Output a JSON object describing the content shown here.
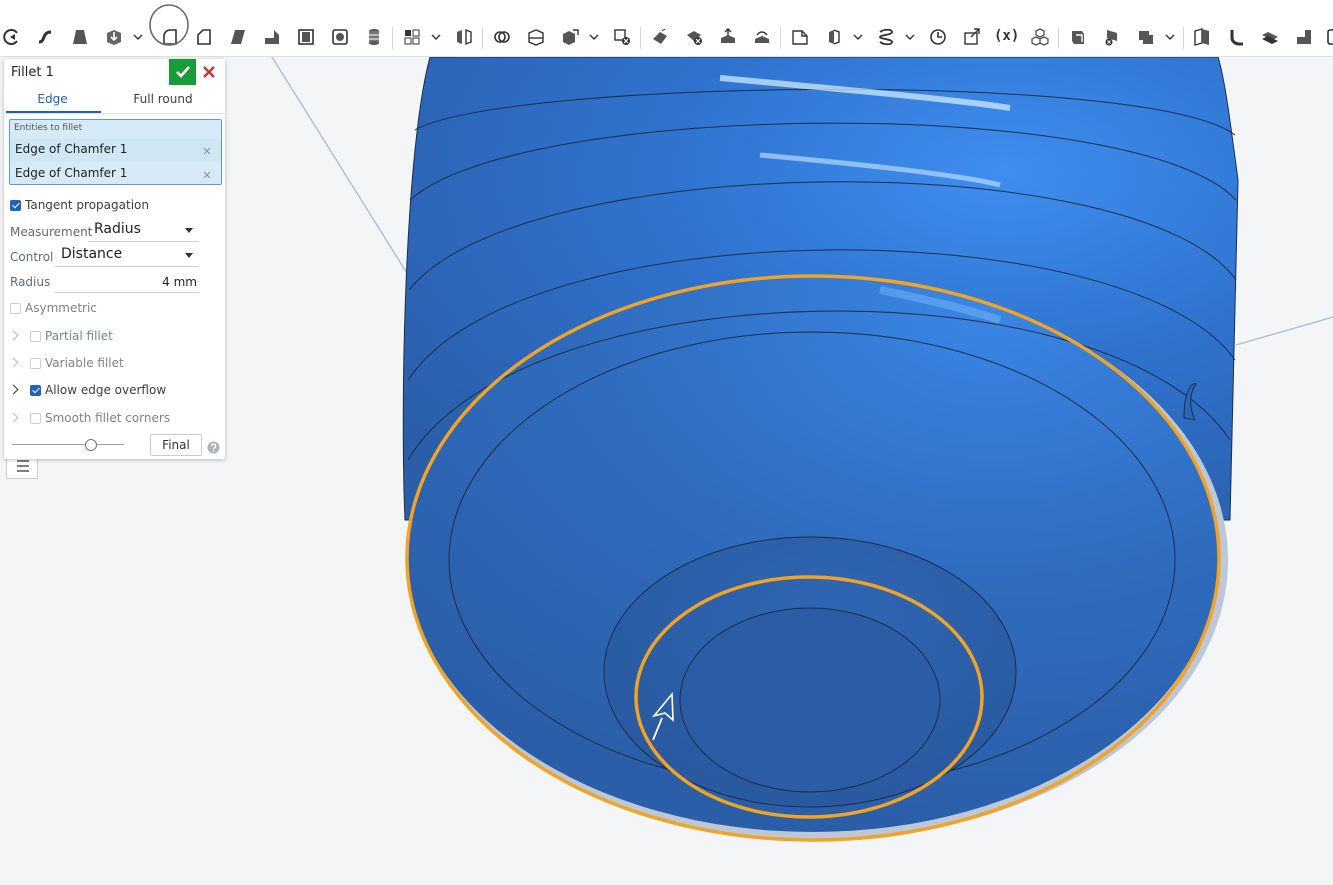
{
  "toolbar": {
    "icons": [
      "sketch-icon",
      "sweep-icon",
      "loft-icon",
      "extrude-icon",
      "fillet-icon",
      "chamfer-icon",
      "draft-icon",
      "rib-icon",
      "shell-icon",
      "hole-icon",
      "thread-icon",
      "pattern-icon",
      "mirror-icon",
      "boolean-icon",
      "split-icon",
      "transform-icon",
      "delete-part-icon",
      "modify-fillet-icon",
      "delete-face-icon",
      "move-face-icon",
      "replace-face-icon",
      "plane-icon",
      "wrap-icon",
      "helix-icon",
      "clock-icon",
      "import-icon",
      "variable-icon",
      "derive-icon",
      "sheet-metal-icon",
      "flange-icon",
      "tab-icon",
      "bend-icon",
      "form-icon",
      "corner-icon",
      "unfold-icon",
      "frame-icon"
    ],
    "variable_label": "(x)"
  },
  "panel": {
    "title": "Fillet 1",
    "accept_color": "#1a9b3a",
    "cancel_color": "#c8323a",
    "tabs": [
      {
        "label": "Edge",
        "active": true
      },
      {
        "label": "Full round",
        "active": false
      }
    ],
    "entities": {
      "label": "Entities to fillet",
      "items": [
        "Edge of Chamfer 1",
        "Edge of Chamfer 1"
      ]
    },
    "tangent_propagation": {
      "label": "Tangent propagation",
      "checked": true
    },
    "measurement": {
      "label": "Measurement",
      "value": "Radius"
    },
    "control": {
      "label": "Control",
      "value": "Distance"
    },
    "radius": {
      "label": "Radius",
      "value": "4 mm"
    },
    "asymmetric": {
      "label": "Asymmetric",
      "checked": false
    },
    "partial_fillet": {
      "label": "Partial fillet",
      "checked": false
    },
    "variable_fillet": {
      "label": "Variable fillet",
      "checked": false
    },
    "allow_edge_overflow": {
      "label": "Allow edge overflow",
      "checked": true
    },
    "smooth_corners": {
      "label": "Smooth fillet corners",
      "checked": false
    },
    "preview_slider": {
      "position": 0.7
    },
    "final_button": "Final",
    "help_icon": "question-icon"
  },
  "viewport": {
    "part_color": "#2f6fc4",
    "selected_edge_color": "#f0a324"
  }
}
